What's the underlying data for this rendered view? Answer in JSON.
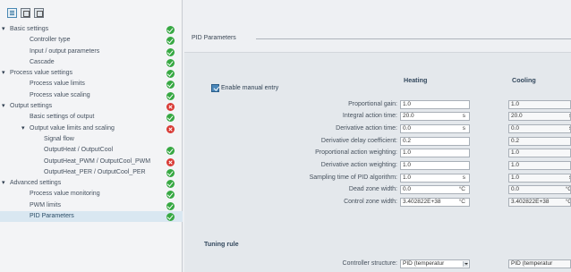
{
  "toolbar": {
    "icons": [
      "tree-view-icon",
      "grid-view-icon",
      "grid-view-alt-icon"
    ]
  },
  "nav": {
    "items": [
      {
        "label": "Basic settings",
        "level": 0,
        "expanded": true,
        "status": "ok"
      },
      {
        "label": "Controller type",
        "level": 1,
        "status": "ok"
      },
      {
        "label": "Input / output parameters",
        "level": 1,
        "status": "ok"
      },
      {
        "label": "Cascade",
        "level": 1,
        "status": "ok"
      },
      {
        "label": "Process value settings",
        "level": 0,
        "expanded": true,
        "status": "ok"
      },
      {
        "label": "Process value limits",
        "level": 1,
        "status": "ok"
      },
      {
        "label": "Process value scaling",
        "level": 1,
        "status": "ok"
      },
      {
        "label": "Output settings",
        "level": 0,
        "expanded": true,
        "status": "err"
      },
      {
        "label": "Basic settings of output",
        "level": 1,
        "status": "ok"
      },
      {
        "label": "Output value limits and scaling",
        "level": 1,
        "expanded": true,
        "status": "err"
      },
      {
        "label": "Signal flow",
        "level": 2,
        "status": "none"
      },
      {
        "label": "OutputHeat / OutputCool",
        "level": 2,
        "status": "ok"
      },
      {
        "label": "OutputHeat_PWM / OutputCool_PWM",
        "level": 2,
        "status": "err"
      },
      {
        "label": "OutputHeat_PER / OutputCool_PER",
        "level": 2,
        "status": "ok"
      },
      {
        "label": "Advanced settings",
        "level": 0,
        "expanded": true,
        "status": "ok"
      },
      {
        "label": "Process value monitoring",
        "level": 1,
        "status": "ok"
      },
      {
        "label": "PWM limits",
        "level": 1,
        "status": "ok"
      },
      {
        "label": "PID Parameters",
        "level": 1,
        "status": "ok",
        "selected": true
      }
    ]
  },
  "section": {
    "title": "PID Parameters"
  },
  "columns": {
    "heating": "Heating",
    "cooling": "Cooling"
  },
  "manual_entry": {
    "label": "Enable manual entry",
    "checked": true
  },
  "params": [
    {
      "label": "Proportional gain:",
      "heating": "1.0",
      "heating_unit": "",
      "cooling": "1.0",
      "cooling_unit": ""
    },
    {
      "label": "Integral action time:",
      "heating": "20.0",
      "heating_unit": "s",
      "cooling": "20.0",
      "cooling_unit": "s"
    },
    {
      "label": "Derivative action time:",
      "heating": "0.0",
      "heating_unit": "s",
      "cooling": "0.0",
      "cooling_unit": "s"
    },
    {
      "label": "Derivative delay coefficient:",
      "heating": "0.2",
      "heating_unit": "",
      "cooling": "0.2",
      "cooling_unit": ""
    },
    {
      "label": "Proportional action weighting:",
      "heating": "1.0",
      "heating_unit": "",
      "cooling": "1.0",
      "cooling_unit": ""
    },
    {
      "label": "Derivative action weighting:",
      "heating": "1.0",
      "heating_unit": "",
      "cooling": "1.0",
      "cooling_unit": ""
    },
    {
      "label": "Sampling time of PID algorithm:",
      "heating": "1.0",
      "heating_unit": "s",
      "cooling": "1.0",
      "cooling_unit": "s"
    },
    {
      "label": "Dead zone width:",
      "heating": "0.0",
      "heating_unit": "°C",
      "cooling": "0.0",
      "cooling_unit": "°C"
    },
    {
      "label": "Control zone width:",
      "heating": "3.402822E+38",
      "heating_unit": "°C",
      "cooling": "3.402822E+38",
      "cooling_unit": "°C"
    }
  ],
  "tuning": {
    "title": "Tuning rule",
    "structure_label": "Controller structure:",
    "heating_value": "PID (temperatur",
    "cooling_value": "PID (temperatur"
  },
  "colors": {
    "ok": "#36a842",
    "error": "#d93a35",
    "selected": "#d9e7f1",
    "checkbox": "#4a87ba"
  }
}
